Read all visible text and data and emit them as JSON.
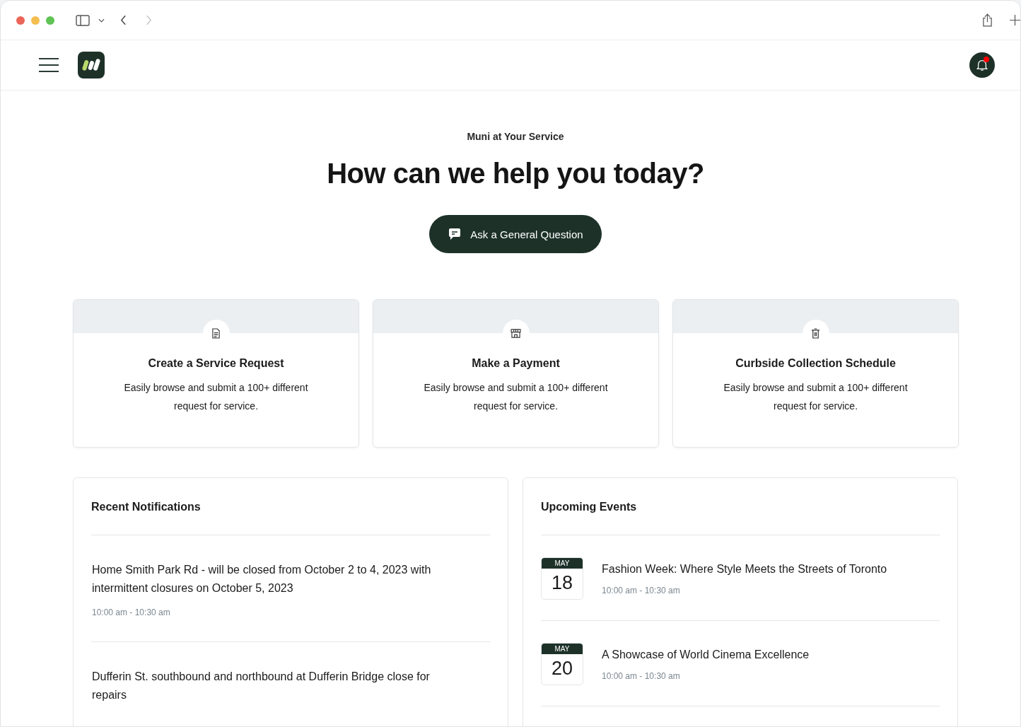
{
  "browser": {
    "back_disabled": false,
    "forward_disabled": true
  },
  "header": {
    "has_unread_notifications": true
  },
  "hero": {
    "eyebrow": "Muni at Your Service",
    "title": "How can we help you today?",
    "button": "Ask a General Question"
  },
  "services": [
    {
      "kind": "document",
      "title": "Create a Service Request",
      "description": "Easily browse and  submit a 100+ different request for service."
    },
    {
      "kind": "store",
      "title": "Make a Payment",
      "description": "Easily browse and  submit a 100+ different request for service."
    },
    {
      "kind": "trash",
      "title": "Curbside Collection Schedule",
      "description": "Easily browse and  submit a 100+ different request for service."
    }
  ],
  "notifications": {
    "title": "Recent Notifications",
    "items": [
      {
        "text": "Home Smith Park Rd - will be closed from October 2 to 4, 2023 with intermittent closures on October 5, 2023",
        "time": "10:00 am - 10:30 am"
      },
      {
        "text": "Dufferin St. southbound and northbound at Dufferin Bridge close for repairs"
      }
    ]
  },
  "events": {
    "title": "Upcoming Events",
    "items": [
      {
        "month": "MAY",
        "day": "18",
        "title": "Fashion Week: Where Style Meets the Streets of Toronto",
        "time": "10:00 am - 10:30 am"
      },
      {
        "month": "MAY",
        "day": "20",
        "title": "A Showcase of World Cinema Excellence",
        "time": "10:00 am - 10:30 am"
      }
    ]
  }
}
